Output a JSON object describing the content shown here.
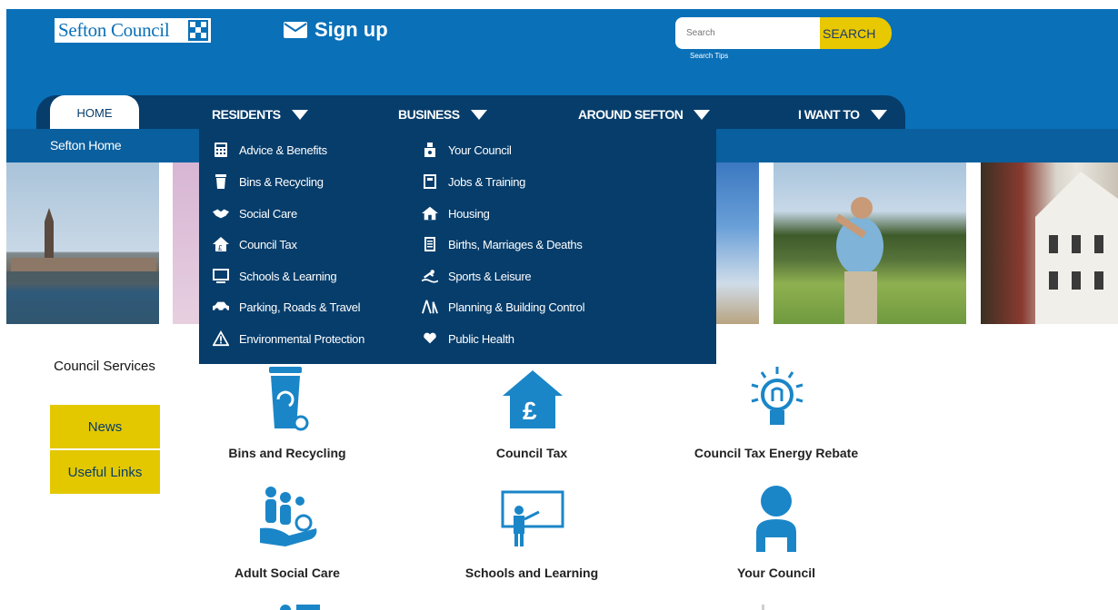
{
  "header": {
    "logo_text": "Sefton Council",
    "signup_label": "Sign up",
    "search_placeholder": "Search",
    "search_button": "SEARCH",
    "search_tips": "Search Tips"
  },
  "nav": {
    "home": "HOME",
    "residents": "RESIDENTS",
    "business": "BUSINESS",
    "around": "AROUND SEFTON",
    "iwant": "I WANT TO"
  },
  "breadcrumb": "Sefton Home",
  "dropdown": {
    "left": [
      "Advice & Benefits",
      "Bins & Recycling",
      "Social Care",
      "Council Tax",
      "Schools & Learning",
      "Parking, Roads & Travel",
      "Environmental Protection"
    ],
    "right": [
      "Your Council",
      "Jobs & Training",
      "Housing",
      "Births, Marriages & Deaths",
      "Sports & Leisure",
      "Planning & Building Control",
      "Public Health"
    ]
  },
  "sidebar": {
    "title": "Council Services",
    "news": "News",
    "links": "Useful Links"
  },
  "tiles": [
    "Bins and Recycling",
    "Council Tax",
    "Council Tax Energy Rebate",
    "Adult Social Care",
    "Schools and Learning",
    "Your Council"
  ],
  "colors": {
    "header_blue": "#0a70b8",
    "nav_dark": "#063d6b",
    "accent_yellow": "#e3c800",
    "icon_blue": "#1a86c8"
  }
}
